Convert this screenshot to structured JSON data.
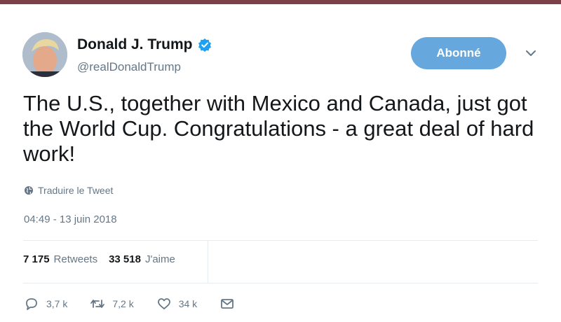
{
  "tweet": {
    "author_name": "Donald J. Trump",
    "handle": "@realDonaldTrump",
    "follow_button": "Abonné",
    "text": "The U.S., together with Mexico and Canada, just got the World Cup. Congratulations - a great deal of hard work!",
    "translate_label": "Traduire le Tweet",
    "timestamp": "04:49 - 13 juin 2018",
    "stats": {
      "retweets_count": "7 175",
      "retweets_label": "Retweets",
      "likes_count": "33 518",
      "likes_label": "J'aime"
    },
    "actions": {
      "reply_count": "3,7 k",
      "retweet_count": "7,2 k",
      "like_count": "34 k"
    }
  },
  "colors": {
    "accent": "#66a8dd",
    "verified": "#1da1f2",
    "muted": "#657786",
    "top_bar": "#7a3f48"
  },
  "icons": [
    "verified-badge-icon",
    "chevron-down-icon",
    "globe-icon",
    "reply-icon",
    "retweet-icon",
    "heart-icon",
    "message-icon"
  ]
}
